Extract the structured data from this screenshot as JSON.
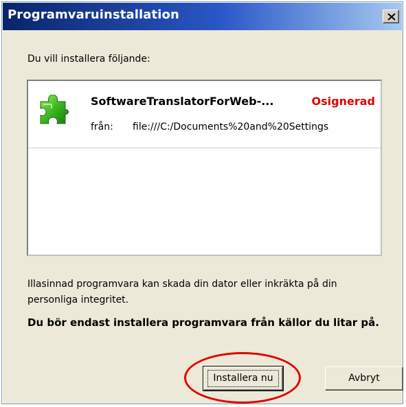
{
  "window": {
    "title": "Programvaruinstallation",
    "close_glyph": "×"
  },
  "intro_text": "Du vill installera följande:",
  "item": {
    "icon": "puzzle-piece-icon",
    "name": "SoftwareTranslatorForWeb-...",
    "status": "Osignerad",
    "status_color": "#e00000",
    "from_label": "från:",
    "url": "file:///C:/Documents%20and%20Settings"
  },
  "warning_text": "Illasinnad programvara kan skada din dator eller inkräkta på din personliga integritet.",
  "advice_text": "Du bör endast installera programvara från källor du litar på.",
  "buttons": {
    "install": "Installera nu",
    "cancel": "Avbryt"
  },
  "annotation": {
    "type": "red-ellipse-highlight",
    "color": "#e00000"
  }
}
